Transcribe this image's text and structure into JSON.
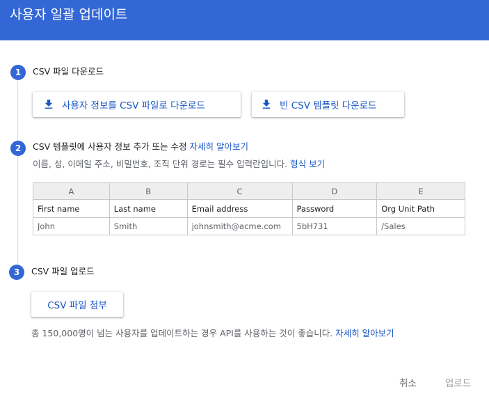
{
  "header": {
    "title": "사용자 일괄 업데이트"
  },
  "step1": {
    "number": "1",
    "title": "CSV 파일 다운로드",
    "download_users_label": "사용자 정보를 CSV 파일로 다운로드",
    "download_template_label": "빈 CSV 템플릿 다운로드"
  },
  "step2": {
    "number": "2",
    "title": "CSV 템플릿에 사용자 정보 추가 또는 수정",
    "learn_more": "자세히 알아보기",
    "description": "이름, 성, 이메일 주소, 비밀번호, 조직 단위 경로는 필수 입력란입니다.",
    "format_link": "형식 보기",
    "table": {
      "columns": [
        "A",
        "B",
        "C",
        "D",
        "E"
      ],
      "headers": [
        "First name",
        "Last name",
        "Email address",
        "Password",
        "Org Unit Path"
      ],
      "row": [
        "John",
        "Smith",
        "johnsmith@acme.com",
        "5bH731",
        "/Sales"
      ]
    }
  },
  "step3": {
    "number": "3",
    "title": "CSV 파일 업로드",
    "attach_label": "CSV 파일 첨부",
    "note": "총 150,000명이 넘는 사용자를 업데이트하는 경우 API를 사용하는 것이 좋습니다.",
    "learn_more": "자세히 알아보기"
  },
  "footer": {
    "cancel_label": "취소",
    "upload_label": "업로드"
  },
  "colors": {
    "accent": "#3367d6",
    "link": "#1a56c4",
    "disabled": "#9aa0a6"
  }
}
